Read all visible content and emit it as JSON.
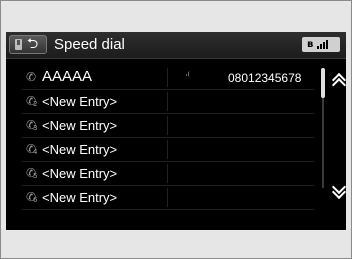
{
  "header": {
    "title": "Speed dial",
    "back_icon": "back-arrow-icon",
    "phone_icon": "phone-device-icon",
    "status": {
      "bluetooth": "ʙ",
      "bluetooth_icon": "bluetooth-icon",
      "signal_icon": "signal-strength-icon"
    }
  },
  "speed_dial": {
    "entries": [
      {
        "slot": "",
        "name": "AAAAA",
        "voice_tag": "ᐧ⁽",
        "number": "08012345678"
      },
      {
        "slot": "2",
        "name": "<New Entry>",
        "voice_tag": "",
        "number": ""
      },
      {
        "slot": "3",
        "name": "<New Entry>",
        "voice_tag": "",
        "number": ""
      },
      {
        "slot": "4",
        "name": "<New Entry>",
        "voice_tag": "",
        "number": ""
      },
      {
        "slot": "5",
        "name": "<New Entry>",
        "voice_tag": "",
        "number": ""
      },
      {
        "slot": "6",
        "name": "<New Entry>",
        "voice_tag": "",
        "number": ""
      }
    ]
  },
  "scroll": {
    "up_icon": "double-chevron-up-icon",
    "down_icon": "double-chevron-down-icon",
    "position": 0
  },
  "colors": {
    "screen_bg": "#000000",
    "text": "#ffffff",
    "surround": "#e6e6e6"
  }
}
